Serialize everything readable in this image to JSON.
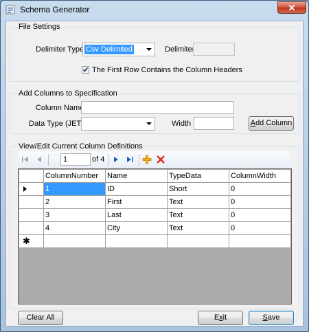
{
  "window": {
    "title": "Schema Generator",
    "close_label": "✕"
  },
  "file_settings": {
    "group_title": "File Settings",
    "delimiter_type_label": "Delimiter Type",
    "delimiter_type_value": "Csv Delimited",
    "delimiter_label": "Delimiter",
    "delimiter_value": "",
    "header_checkbox_label": "The First Row Contains the Column Headers",
    "header_checked": true
  },
  "add_columns": {
    "group_title": "Add Columns to Specification",
    "column_name_label": "Column Name",
    "column_name_value": "",
    "data_type_label": "Data Type (JET)",
    "data_type_value": "",
    "width_label": "Width",
    "width_value": "",
    "add_button_label": "Add Column",
    "add_button_mnemonic": "A",
    "add_button_rest": "dd Column"
  },
  "definitions": {
    "group_title": "View/Edit Current Column Definitions",
    "navigator": {
      "position": "1",
      "count_label": "of 4"
    },
    "columns": [
      "ColumnNumber",
      "Name",
      "TypeData",
      "ColumnWidth"
    ],
    "rows": [
      [
        "1",
        "ID",
        "Short",
        "0"
      ],
      [
        "2",
        "First",
        "Text",
        "0"
      ],
      [
        "3",
        "Last",
        "Text",
        "0"
      ],
      [
        "4",
        "City",
        "Text",
        "0"
      ]
    ]
  },
  "footer": {
    "clear_label": "Clear All",
    "exit_label": "Exit",
    "exit_mnemonic_pre": "E",
    "exit_mnemonic": "x",
    "exit_rest": "it",
    "save_label": "Save",
    "save_mnemonic": "S",
    "save_rest": "ave"
  }
}
